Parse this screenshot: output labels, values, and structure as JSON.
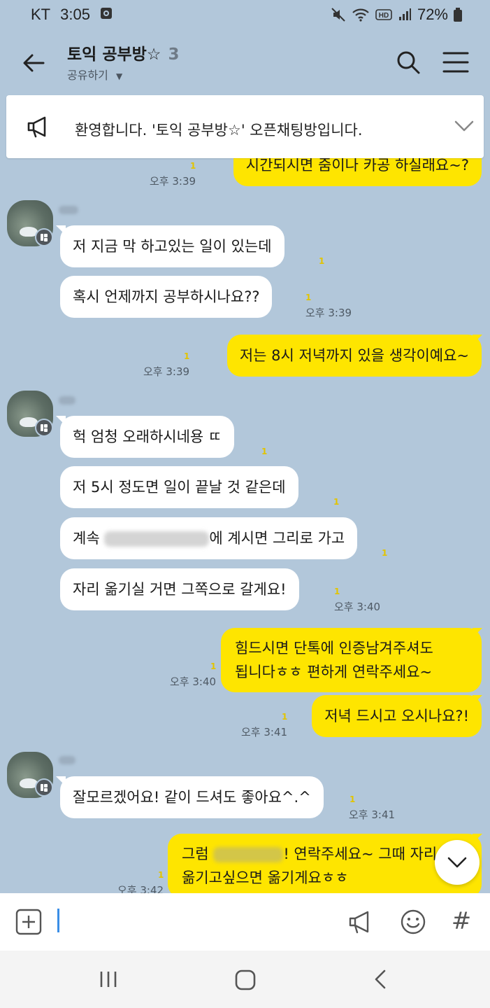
{
  "status_bar": {
    "carrier": "KT",
    "time": "3:05",
    "battery": "72%"
  },
  "header": {
    "title": "토익 공부방☆",
    "member_count": "3",
    "share_label": "공유하기"
  },
  "notice": {
    "text": "환영합니다. '토익 공부방☆' 오픈채팅방입니다."
  },
  "messages": [
    {
      "side": "out",
      "text": "시간되시면 줌이나 카공 하실래요~?",
      "unread": "1",
      "time": "오후 3:39"
    },
    {
      "side": "in",
      "text": "저 지금 막 하고있는 일이 있는데",
      "unread": "1"
    },
    {
      "side": "in",
      "text": "혹시 언제까지 공부하시나요??",
      "unread": "1",
      "time": "오후 3:39"
    },
    {
      "side": "out",
      "text": "저는 8시 저녁까지 있을 생각이예요~",
      "unread": "1",
      "time": "오후 3:39"
    },
    {
      "side": "in",
      "text": "헉 엄청 오래하시네용 ㄸ",
      "unread": "1"
    },
    {
      "side": "in",
      "text": "저 5시 정도면 일이 끝날 것 같은데",
      "unread": "1"
    },
    {
      "side": "in",
      "text_before": "계속",
      "text_after": "에 계시면 그리로 가고",
      "unread": "1"
    },
    {
      "side": "in",
      "text": "자리 옮기실 거면 그쪽으로 갈게요!",
      "unread": "1",
      "time": "오후 3:40"
    },
    {
      "side": "out",
      "line1": "힘드시면 단톡에 인증남겨주셔도",
      "line2": "됩니다ㅎㅎ 편하게 연락주세요~",
      "unread": "1",
      "time": "오후 3:40"
    },
    {
      "side": "out",
      "text": "저녁 드시고 오시나요?!",
      "unread": "1",
      "time": "오후 3:41"
    },
    {
      "side": "in",
      "text": "잘모르겠어요! 같이 드셔도 좋아요^.^",
      "unread": "1",
      "time": "오후 3:41"
    },
    {
      "side": "out",
      "line1_before": "그럼",
      "line1_after": "! 연락주세요~ 그때 자리",
      "line2": "옮기고싶으면 옮기게요ㅎㅎ",
      "unread": "1",
      "time": "오후 3:42"
    }
  ],
  "input": {
    "placeholder": "",
    "hash_label": "#"
  },
  "icons": {
    "back": "arrow-left-icon",
    "search": "search-icon",
    "menu": "hamburger-menu-icon",
    "notice": "megaphone-icon",
    "notice_expand": "chevron-down-icon",
    "scroll_down": "chevron-down-icon",
    "plus": "plus-box-icon",
    "shout": "megaphone-icon",
    "emoji": "smiley-icon"
  },
  "colors": {
    "background": "#b2c7da",
    "my_bubble": "#fee500",
    "other_bubble": "#ffffff",
    "unread": "#e2c400"
  }
}
